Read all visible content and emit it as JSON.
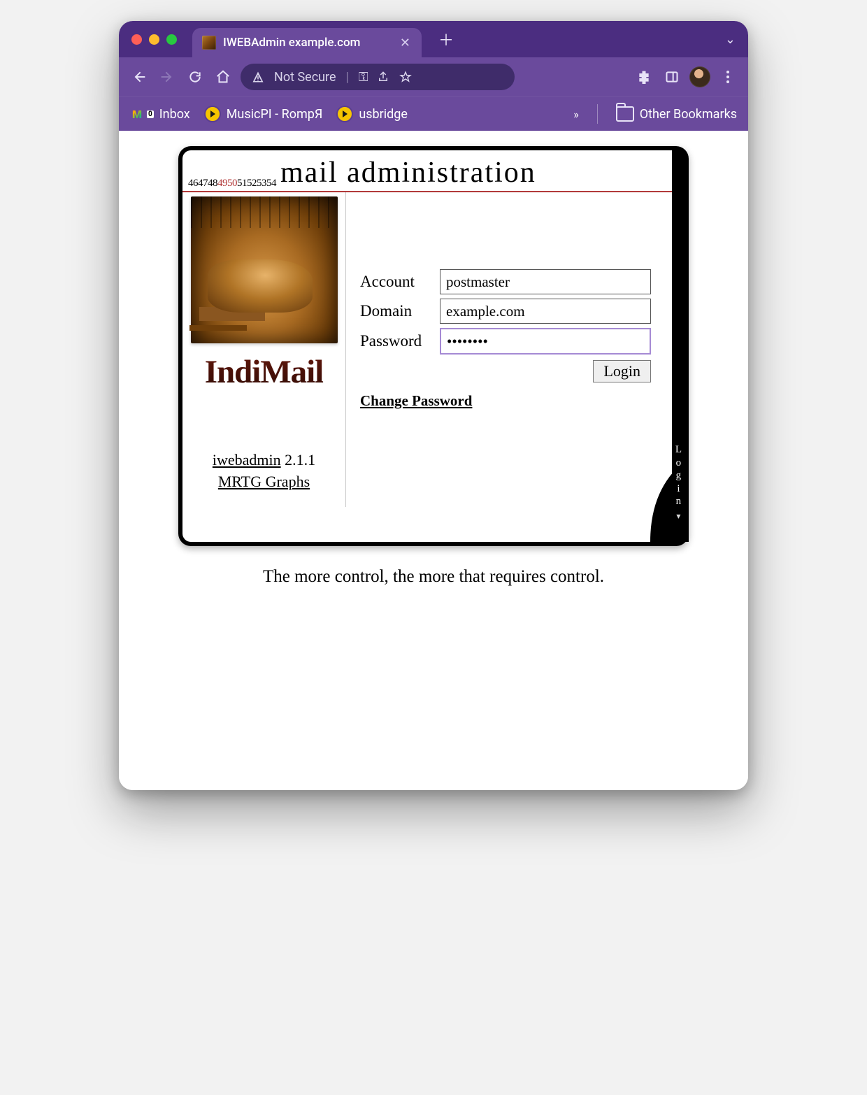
{
  "tab": {
    "title": "IWEBAdmin example.com"
  },
  "addressbar": {
    "security_label": "Not Secure"
  },
  "bookmarks": {
    "inbox": "Inbox",
    "musicpi": "MusicPI - RompЯ",
    "usbridge": "usbridge",
    "other": "Other Bookmarks",
    "overflow": "»"
  },
  "panel": {
    "prefix_a": "464748",
    "prefix_mid": "4950",
    "prefix_b": "51525354",
    "title": "mail administration",
    "product": "IndiMail",
    "left_links": {
      "iwebadmin": "iwebadmin",
      "version": " 2.1.1",
      "mrtg": "MRTG Graphs"
    },
    "form": {
      "account_label": "Account",
      "account_value": "postmaster",
      "domain_label": "Domain",
      "domain_value": "example.com",
      "password_label": "Password",
      "password_value": "••••••••",
      "login_button": "Login",
      "change_password": "Change Password"
    },
    "side_label_chars": [
      "L",
      "o",
      "g",
      "i",
      "n"
    ]
  },
  "quote": "The more control, the more that requires control."
}
